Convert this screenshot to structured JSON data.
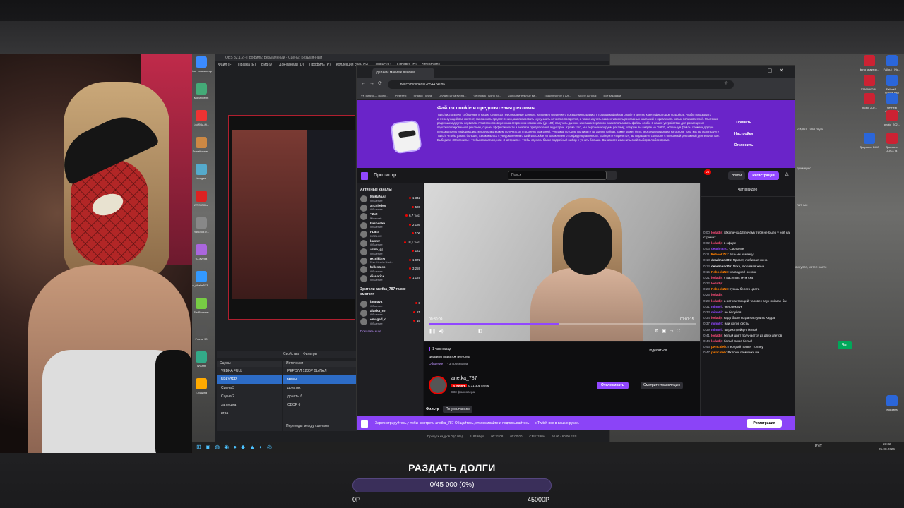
{
  "obs": {
    "title": "OBS 32.1.2 - Профиль: Безымянный - Сцены: Безымянный",
    "menu": [
      "Файл (F)",
      "Правка (E)",
      "Вид (V)",
      "Док-панели (D)",
      "Профиль (P)",
      "Коллекция сцен (S)",
      "Сервис (T)",
      "Справка (H)",
      "Streamlabs"
    ],
    "scenes_header": "Сцены",
    "sources_header": "Источники",
    "scenes": [
      "VEBKA FULL",
      "БРАУЗЕР",
      "Сцена 3",
      "Сцена 2",
      "заглушка",
      "игра"
    ],
    "sources": [
      "РЕРОЛЛ 1280P ВЫПАЛ",
      "мемы",
      "донатик",
      "донаты б",
      "СБОР 6"
    ],
    "scene_btns": [
      "Свойства",
      "Фильтры"
    ],
    "transitions_label": "Переходы между сценами",
    "status": [
      "Пропуск кадров 0 (0.0%)",
      "6184 kbps",
      "00:31:08",
      "00:00:00",
      "CPU: 3.6%",
      "60.00 / 60.00 FPS"
    ]
  },
  "chrome": {
    "tab_title": "делаем макияж венома",
    "url": "twitch.tv/videos/2854424086",
    "bookmarks": [
      "VK Видео — смотр...",
      "Pinterest",
      "Яндекс Почта",
      "Онлайн Игра Кухня...",
      "Черновик Пьяно Во...",
      "Дополнительные ви...",
      "Подключение к Ал...",
      "Adobe Acrobat",
      "Все закладки"
    ]
  },
  "cookie": {
    "heading": "Файлы cookie и предпочтения рекламы",
    "body": "Twitch использует собранные в наших сервисах персональные данные, например сведения о посещении страниц, с помощью файлов cookie и других идентификаторов устройств, чтобы показывать интересующий вас контент, запоминать предпочтения, анализировать и улучшать качество продуктов, а также изучать эффективность рекламных кампаний и привлекать новых пользователей. Мы также разрешаем другим сервисам Amazon и проверенным сторонним компаниям (до 103) получать данные из наших сервисов или использовать файлы cookie в наших устройствах для размещения персонализированной рекламы, оценки эффективности и анализа предпочтений аудитории. Кроме того, мы персонализируем рекламу, которую вы видите на Twitch, используя файлы cookie и другую персональную информацию, которую мы можем получать от сторонних компаний. Реклама, которую вы видите на других сайтах, также может быть персонализирована на основе того, как вы используете Twitch. Чтобы узнать больше, ознакомьтесь с уведомлением о файлах cookie и Положением о конфиденциальности. Выберите «Принять», вы выражаете согласие с описанной рекламной деятельностью. Выберите «Отклонить», чтобы отказаться, или «Настроить», чтобы сделать более подробный выбор и узнать больше. Вы можете изменить свой выбор в любое время.",
    "accept": "Принять",
    "settings": "Настройки",
    "reject": "Отклонить"
  },
  "twitch": {
    "browse": "Просмотр",
    "search_placeholder": "Поиск",
    "login": "Войти",
    "signup": "Регистрация",
    "notif_count": "24",
    "side_header": "Активные каналы",
    "channels": [
      {
        "name": "MuHaNjAn",
        "game": "Общение",
        "viewers": "1 342"
      },
      {
        "name": "Archiedos",
        "game": "Общение",
        "viewers": "500"
      },
      {
        "name": "T2x2",
        "game": "Minecraft",
        "viewers": "6,7 тыс."
      },
      {
        "name": "Fasoollka",
        "game": "Общение",
        "viewers": "2 186"
      },
      {
        "name": "FLIES",
        "game": "ROBLOX",
        "viewers": "106"
      },
      {
        "name": "buster",
        "game": "Общение",
        "viewers": "18,1 тыс."
      },
      {
        "name": "arina_gp",
        "game": "Общение",
        "viewers": "122"
      },
      {
        "name": "reznikbtw",
        "game": "Five Hearts Und...",
        "viewers": "1 972"
      },
      {
        "name": "follentass",
        "game": "Общение",
        "viewers": "3 259"
      },
      {
        "name": "dianarice",
        "game": "Общение",
        "viewers": "1 129"
      }
    ],
    "also_watch_header": "Зрители anetka_787 также смотрят",
    "also_watch": [
      {
        "name": "itmpaya",
        "game": "Общение",
        "viewers": "8"
      },
      {
        "name": "alaska_rrr",
        "game": "Общение",
        "viewers": "21"
      },
      {
        "name": "omagad_d",
        "game": "Общение",
        "viewers": "16"
      }
    ],
    "show_more": "Показать еще",
    "player": {
      "elapsed": "00:30:09",
      "total": "01:01:15",
      "progress": 0.49
    },
    "video_ago": "1 час назад",
    "video_title": "делаем макияж венома",
    "video_meta_game": "Общение",
    "video_meta_views": "· 3 просмотра",
    "share": "Поделиться",
    "streamer": "anetka_787",
    "live_badge": "В ЭФИРЕ",
    "live_viewers": "с 31 зрителем",
    "followers": "833 фолловера",
    "follow": "Отслеживать",
    "watch_stream": "Смотрите трансляцию",
    "filter_label": "Фильтр",
    "filter_value": "По умолчанию",
    "chat_header": "Чат в видео",
    "chat": [
      {
        "t": "0:00",
        "u": "lodadjr",
        "c": "#ff4d7a",
        "m": "@kсmечka13 почему тебя не было у неё на стримах"
      },
      {
        "t": "0:02",
        "u": "lodadjr",
        "c": "#ff4d7a",
        "m": "в эфире"
      },
      {
        "t": "0:03",
        "u": "deadmand",
        "c": "#9147ff",
        "m": "Смотрите"
      },
      {
        "t": "0:11",
        "u": "RebookZzz",
        "c": "#ff7f00",
        "m": "возьми замазку"
      },
      {
        "t": "0:13",
        "u": "deadmand05",
        "c": "#efeff1",
        "m": "Привет, любимая жена"
      },
      {
        "t": "0:14",
        "u": "deadmand05",
        "c": "#efeff1",
        "m": "Пока, любимая жена"
      },
      {
        "t": "0:15",
        "u": "RebookZzz",
        "c": "#ff7f00",
        "m": "на водной основе"
      },
      {
        "t": "0:21",
        "u": "lodadjr",
        "c": "#ff4d7a",
        "m": "у вас у вас муж уха"
      },
      {
        "t": "0:22",
        "u": "lodadjr",
        "c": "#ff4d7a",
        "m": ""
      },
      {
        "t": "0:23",
        "u": "RebookZzz",
        "c": "#ff7f00",
        "m": "гуашь белого цвета"
      },
      {
        "t": "0:25",
        "u": "lodadjr",
        "c": "#ff4d7a",
        "m": ""
      },
      {
        "t": "0:29",
        "u": "lodadjr",
        "c": "#ff4d7a",
        "m": "а вот настоящий человек паук пойман бы"
      },
      {
        "t": "0:31",
        "u": "minn0ll",
        "c": "#9147ff",
        "m": "человек пук"
      },
      {
        "t": "0:33",
        "u": "minn0ll",
        "c": "#9147ff",
        "m": "не балуйся"
      },
      {
        "t": "0:34",
        "u": "lodadjr",
        "c": "#ff4d7a",
        "m": "надо было когда наступить Карра"
      },
      {
        "t": "0:37",
        "u": "minn0ll",
        "c": "#9147ff",
        "m": "или жогой сесть"
      },
      {
        "t": "0:39",
        "u": "minn0ll",
        "c": "#9147ff",
        "m": "штрих пройдет белый"
      },
      {
        "t": "0:41",
        "u": "lodadjr",
        "c": "#ff4d7a",
        "m": "белый цвет получается из двух цветов"
      },
      {
        "t": "0:44",
        "u": "lodadjr",
        "c": "#ff4d7a",
        "m": "белый плюс белый"
      },
      {
        "t": "0:46",
        "u": "pwncaleb",
        "c": "#ff7f00",
        "m": "Передай привет толяну"
      },
      {
        "t": "0:47",
        "u": "pwncaleb",
        "c": "#ff7f00",
        "m": "Включи лампочки пж"
      }
    ],
    "banner": "Зарегистрируйтесь, чтобы смотреть anetka_787 Общайтесь, отслеживайте и подписывайтесь — с Twitch все в ваших руках.",
    "banner_btn": "Регистрация"
  },
  "desktop_icons_left": [
    "Этот компьютер",
    "MobaXterm",
    "14df95a-f0...",
    "Donationale...",
    "images",
    "WPS Office",
    "7b8c4087f...",
    "07-вvega",
    "c_09abe513...",
    "Tor Browser",
    "Frame 90",
    "WCam",
    "T-Mazing"
  ],
  "desktop_icons_right": [
    "фото квартир...",
    "Fallout - Nic...",
    "12369902f6...",
    "Fallout1 - Voices.lnk2",
    "photo_202...",
    "seyneel documents",
    "photo_202...",
    "Документ DOC",
    "Документ DOCX (4)",
    "Корзина"
  ],
  "tray": {
    "lang": "РУС",
    "time": "23:32",
    "date": "25.08.2026"
  },
  "stray_text": [
    "открыт. тока надо",
    "примерно",
    "латные",
    "охнулся, хотел насте"
  ],
  "stray_btn": "Чат",
  "goal": {
    "title": "РАЗДАТЬ ДОЛГИ",
    "progress_text": "0/45 000 (0%)",
    "min": "0Р",
    "max": "45000Р",
    "progress": 0
  }
}
